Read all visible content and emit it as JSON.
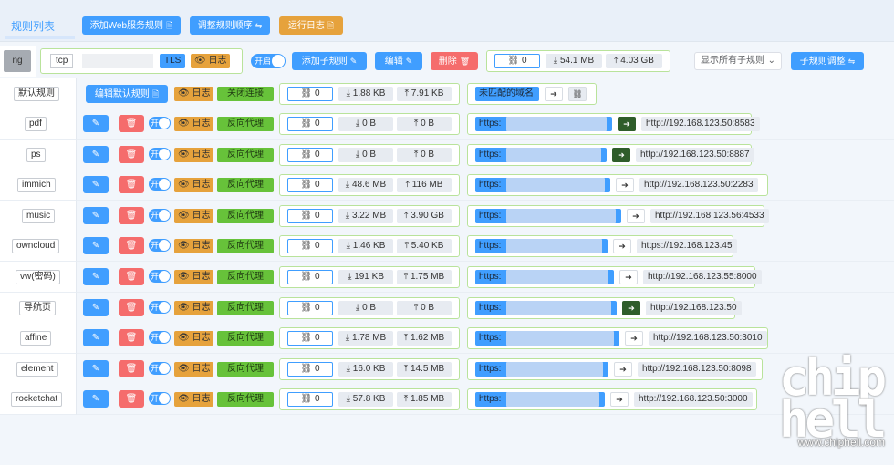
{
  "topbar": {
    "title": "规则列表",
    "add_web_rule": "添加Web服务规则",
    "adjust_order": "调整规则顺序",
    "run_log": "运行日志"
  },
  "service": {
    "name": "ng",
    "protocol": "tcp",
    "tls": "TLS",
    "log": "日志",
    "toggle": "开启",
    "add_sub_rule": "添加子规则",
    "edit": "编辑",
    "delete": "删除",
    "conn": "0",
    "download": "54.1 MB",
    "upload": "4.03 GB",
    "show_select": "显示所有子规则",
    "sub_adjust": "子规则调整"
  },
  "default_rule": {
    "name": "默认规则",
    "edit": "编辑默认规则",
    "log": "日志",
    "close_conn": "关闭连接",
    "conn": "0",
    "download": "1.88 KB",
    "upload": "7.91 KB",
    "unmatched": "未匹配的域名"
  },
  "labels": {
    "log": "日志",
    "toggle": "开",
    "proxy": "反向代理",
    "https": "https:"
  },
  "rules": [
    {
      "name": "pdf",
      "conn": "0",
      "download": "0 B",
      "upload": "0 B",
      "target": "http://192.168.123.50:8583",
      "arrow": "dark"
    },
    {
      "name": "ps",
      "conn": "0",
      "download": "0 B",
      "upload": "0 B",
      "target": "http://192.168.123.50:8887",
      "arrow": "dark"
    },
    {
      "name": "immich",
      "conn": "0",
      "download": "48.6 MB",
      "upload": "116 MB",
      "target": "http://192.168.123.50:2283",
      "arrow": "light"
    },
    {
      "name": "music",
      "conn": "0",
      "download": "3.22 MB",
      "upload": "3.90 GB",
      "target": "http://192.168.123.56:4533",
      "arrow": "light"
    },
    {
      "name": "owncloud",
      "conn": "0",
      "download": "1.46 KB",
      "upload": "5.40 KB",
      "target": "https://192.168.123.45",
      "arrow": "light"
    },
    {
      "name": "vw(密码)",
      "conn": "0",
      "download": "191 KB",
      "upload": "1.75 MB",
      "target": "http://192.168.123.55:8000",
      "arrow": "light"
    },
    {
      "name": "导航页",
      "conn": "0",
      "download": "0 B",
      "upload": "0 B",
      "target": "http://192.168.123.50",
      "arrow": "dark"
    },
    {
      "name": "affine",
      "conn": "0",
      "download": "1.78 MB",
      "upload": "1.62 MB",
      "target": "http://192.168.123.50:3010",
      "arrow": "light"
    },
    {
      "name": "element",
      "conn": "0",
      "download": "16.0 KB",
      "upload": "14.5 MB",
      "target": "http://192.168.123.50:8098",
      "arrow": "light"
    },
    {
      "name": "rocketchat",
      "conn": "0",
      "download": "57.8 KB",
      "upload": "1.85 MB",
      "target": "http://192.168.123.50:3000",
      "arrow": "light"
    }
  ],
  "watermark": {
    "logo": "chip hell",
    "site": "www.chiphell.com"
  },
  "colors": {
    "primary": "#409eff",
    "warning": "#e6a23c",
    "danger": "#f56c6c",
    "success": "#67c23a"
  }
}
